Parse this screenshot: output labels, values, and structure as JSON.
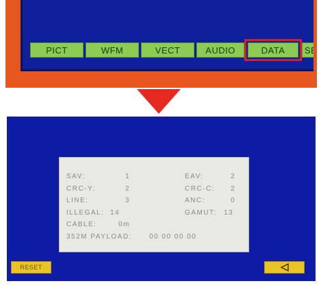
{
  "menu": {
    "buttons": [
      {
        "label": "PICT"
      },
      {
        "label": "WFM"
      },
      {
        "label": "VECT"
      },
      {
        "label": "AUDIO"
      },
      {
        "label": "DATA"
      },
      {
        "label": "SE"
      }
    ],
    "selected": "DATA"
  },
  "data_panel": {
    "sav_label": "SAV:",
    "sav_value": "1",
    "eav_label": "EAV:",
    "eav_value": "2",
    "crcy_label": "CRC-Y:",
    "crcy_value": "2",
    "crcc_label": "CRC-C:",
    "crcc_value": "2",
    "line_label": "LINE:",
    "line_value": "3",
    "anc_label": "ANC:",
    "anc_value": "0",
    "illegal_label": "ILLEGAL:",
    "illegal_value": "14",
    "gamut_label": "GAMUT:",
    "gamut_value": "13",
    "cable_label": "CABLE:",
    "cable_value": "0m",
    "payload_label": "352M PAYLOAD:",
    "payload_value": "00 00 00 00"
  },
  "soft_buttons": {
    "reset_label": "RESET",
    "back_icon": "triangle-left-icon"
  },
  "colors": {
    "bezel": "#e4561d",
    "screen": "#0d1ca3",
    "menu_button": "#8dcc54",
    "highlight": "#d62028",
    "soft_button": "#e9c423"
  }
}
